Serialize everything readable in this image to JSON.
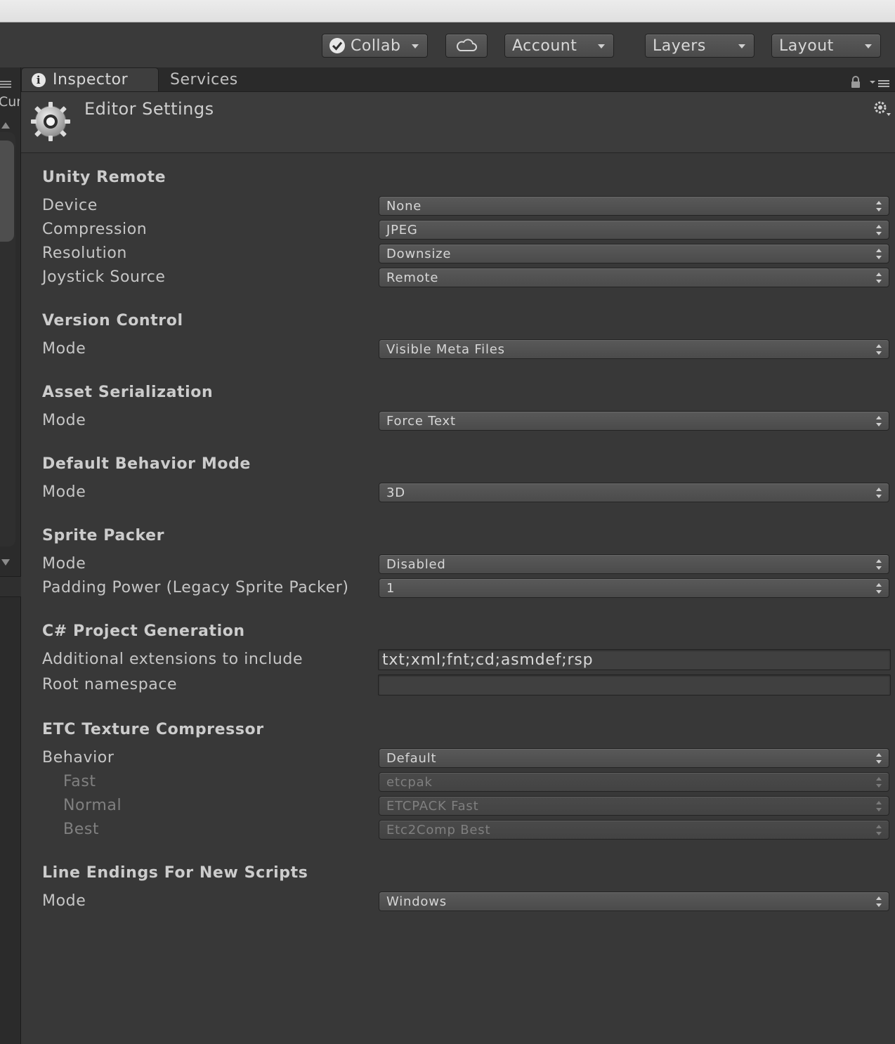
{
  "toolbar": {
    "collab_label": "Collab",
    "account_label": "Account",
    "layers_label": "Layers",
    "layout_label": "Layout"
  },
  "tabs": {
    "inspector": "Inspector",
    "services": "Services"
  },
  "left_pane": {
    "clipped_label": "Cur"
  },
  "header": {
    "title": "Editor Settings"
  },
  "sections": {
    "unity_remote": {
      "title": "Unity Remote",
      "device": {
        "label": "Device",
        "value": "None"
      },
      "compression": {
        "label": "Compression",
        "value": "JPEG"
      },
      "resolution": {
        "label": "Resolution",
        "value": "Downsize"
      },
      "joystick": {
        "label": "Joystick Source",
        "value": "Remote"
      }
    },
    "version_control": {
      "title": "Version Control",
      "mode": {
        "label": "Mode",
        "value": "Visible Meta Files"
      }
    },
    "asset_serialization": {
      "title": "Asset Serialization",
      "mode": {
        "label": "Mode",
        "value": "Force Text"
      }
    },
    "default_behavior": {
      "title": "Default Behavior Mode",
      "mode": {
        "label": "Mode",
        "value": "3D"
      }
    },
    "sprite_packer": {
      "title": "Sprite Packer",
      "mode": {
        "label": "Mode",
        "value": "Disabled"
      },
      "padding": {
        "label": "Padding Power (Legacy Sprite Packer)",
        "value": "1"
      }
    },
    "csharp": {
      "title": "C# Project Generation",
      "extensions": {
        "label": "Additional extensions to include",
        "value": "txt;xml;fnt;cd;asmdef;rsp"
      },
      "namespace": {
        "label": "Root namespace",
        "value": ""
      }
    },
    "etc": {
      "title": "ETC Texture Compressor",
      "behavior": {
        "label": "Behavior",
        "value": "Default"
      },
      "fast": {
        "label": "Fast",
        "value": "etcpak"
      },
      "normal": {
        "label": "Normal",
        "value": "ETCPACK Fast"
      },
      "best": {
        "label": "Best",
        "value": "Etc2Comp Best"
      }
    },
    "line_endings": {
      "title": "Line Endings For New Scripts",
      "mode": {
        "label": "Mode",
        "value": "Windows"
      }
    }
  },
  "colors": {
    "background": "#383838",
    "toolbar": "#3a3a3a",
    "text": "#c6c6c6",
    "dim_text": "#808080"
  }
}
